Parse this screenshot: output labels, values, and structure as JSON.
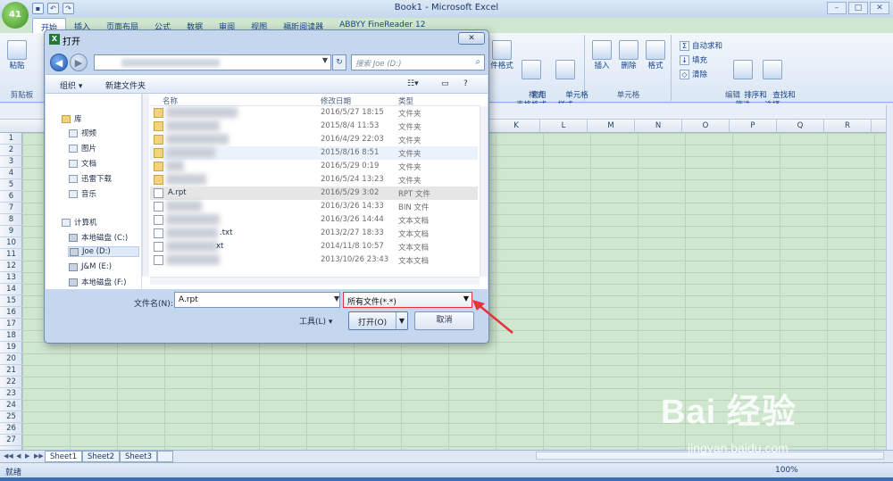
{
  "app": {
    "title": "Book1 - Microsoft Excel",
    "office_button_label": "41",
    "window_controls": [
      "–",
      "□",
      "✕"
    ]
  },
  "tabs": [
    "开始",
    "插入",
    "页面布局",
    "公式",
    "数据",
    "审阅",
    "视图",
    "福昕阅读器",
    "ABBYY FineReader 12"
  ],
  "ribbon": {
    "clipboard": {
      "paste": "粘贴",
      "group": "剪贴板"
    },
    "styles": {
      "table_format": "套用\n表格格式",
      "cell_style": "单元格\n样式",
      "cond_format": "件格式",
      "group": "样式"
    },
    "cells": {
      "insert": "插入",
      "delete": "删除",
      "format": "格式",
      "group": "单元格"
    },
    "editing": {
      "autosum": "自动求和",
      "fill": "填充",
      "clear": "清除",
      "sort": "排序和\n筛选",
      "find": "查找和\n选择",
      "group": "编辑"
    }
  },
  "sheet": {
    "columns": [
      "K",
      "L",
      "M",
      "N",
      "O",
      "P",
      "Q",
      "R"
    ],
    "rows": [
      "1",
      "2",
      "3",
      "4",
      "5",
      "6",
      "7",
      "8",
      "9",
      "10",
      "11",
      "12",
      "13",
      "14",
      "15",
      "16",
      "17",
      "18",
      "19",
      "20",
      "21",
      "22",
      "23",
      "24",
      "25",
      "26",
      "27"
    ],
    "tabs": [
      "Sheet1",
      "Sheet2",
      "Sheet3"
    ]
  },
  "status": {
    "text": "就绪",
    "zoom": "100%"
  },
  "dialog": {
    "title": "打开",
    "close": "✕",
    "search_placeholder": "搜索 Joe (D:)",
    "toolbar": {
      "organize": "组织 ▾",
      "new_folder": "新建文件夹"
    },
    "nav": [
      {
        "label": "库",
        "icon": "library-icon"
      },
      {
        "label": "视频",
        "icon": "video-icon"
      },
      {
        "label": "图片",
        "icon": "picture-icon"
      },
      {
        "label": "文档",
        "icon": "document-icon"
      },
      {
        "label": "迅雷下载",
        "icon": "download-icon"
      },
      {
        "label": "音乐",
        "icon": "music-icon"
      },
      {
        "label": "计算机",
        "icon": "computer-icon"
      },
      {
        "label": "本地磁盘 (C:)",
        "icon": "drive-icon"
      },
      {
        "label": "Joe (D:)",
        "icon": "drive-icon"
      },
      {
        "label": "J&M (E:)",
        "icon": "drive-icon"
      },
      {
        "label": "本地磁盘 (F:)",
        "icon": "drive-icon"
      }
    ],
    "file_columns": {
      "name": "名称",
      "date": "修改日期",
      "type": "类型"
    },
    "files": [
      {
        "name": "",
        "date": "2016/5/27 18:15",
        "type": "文件夹",
        "icon": "folder"
      },
      {
        "name": "",
        "date": "2015/8/4 11:53",
        "type": "文件夹",
        "icon": "folder"
      },
      {
        "name": "",
        "date": "2016/4/29 22:03",
        "type": "文件夹",
        "icon": "folder"
      },
      {
        "name": "",
        "date": "2015/8/16 8:51",
        "type": "文件夹",
        "icon": "folder"
      },
      {
        "name": "",
        "date": "2016/5/29 0:19",
        "type": "文件夹",
        "icon": "folder"
      },
      {
        "name": "",
        "date": "2016/5/24 13:23",
        "type": "文件夹",
        "icon": "folder"
      },
      {
        "name": "A.rpt",
        "date": "2016/5/29 3:02",
        "type": "RPT 文件",
        "icon": "doc"
      },
      {
        "name": "",
        "date": "2016/3/26 14:33",
        "type": "BIN 文件",
        "icon": "doc"
      },
      {
        "name": "",
        "date": "2016/3/26 14:44",
        "type": "文本文档",
        "icon": "doc"
      },
      {
        "name": ".txt",
        "date": "2013/2/27 18:33",
        "type": "文本文档",
        "icon": "doc"
      },
      {
        "name": "xt",
        "date": "2014/11/8 10:57",
        "type": "文本文档",
        "icon": "doc"
      },
      {
        "name": "",
        "date": "2013/10/26 23:43",
        "type": "文本文档",
        "icon": "doc"
      }
    ],
    "filename_label": "文件名(N):",
    "filename_value": "A.rpt",
    "filetype_value": "所有文件(*.*)",
    "tools_label": "工具(L)",
    "open_label": "打开(O)",
    "cancel_label": "取消"
  },
  "watermark": {
    "logo": "Bai 经验",
    "url": "jingyan.baidu.com"
  }
}
